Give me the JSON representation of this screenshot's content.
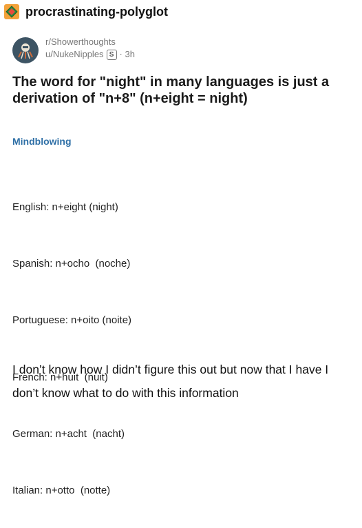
{
  "blog": {
    "name": "procrastinating-polyglot",
    "avatar_icon": "diamond-icon",
    "avatar_color": "#f3a23a"
  },
  "post": {
    "subreddit": "r/Showerthoughts",
    "user": "u/NukeNipples",
    "badge": "S",
    "time": "· 3h",
    "avatar_icon": "robot-icon",
    "title": "The word for \"night\" in many languages is just a derivation of \"n+8\" (n+eight = night)",
    "flair": "Mindblowing",
    "flair_color": "#2e6fa6"
  },
  "translations": [
    "English: n+eight (night)",
    "Spanish: n+ocho  (noche)",
    "Portuguese: n+oito (noite)",
    "French: n+huit  (nuit)",
    "German: n+acht  (nacht)",
    "Italian: n+otto  (notte)"
  ],
  "comment": "I don’t know how I didn’t figure this out but now that I have I don’t know what to do with this information"
}
